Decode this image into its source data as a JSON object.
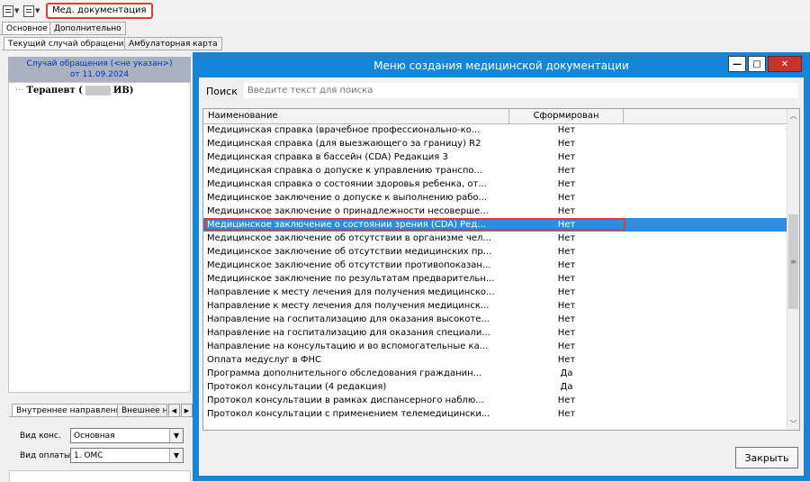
{
  "toolbar": {
    "menu_label": "Мед. документация",
    "icons": [
      "document-icon",
      "list-icon"
    ]
  },
  "top_tabs": [
    "Основное",
    "Дополнительно"
  ],
  "case_tabs": [
    "Текущий случай обращения",
    "Амбулаторная карта"
  ],
  "left_panel": {
    "case_title": "Случай обращения (<не указан>)",
    "case_date": "от 11.09.2024",
    "tree_item_prefix": "Терапевт (",
    "tree_item_suffix": " ИВ)",
    "bottom_tabs": [
      "Внутреннее направление",
      "Внешнее на"
    ],
    "fields": [
      {
        "label": "Вид конс.",
        "value": "Основная"
      },
      {
        "label": "Вид оплаты",
        "value": "1. ОМС"
      }
    ]
  },
  "dialog": {
    "title": "Меню создания медицинской документации",
    "search_label": "Поиск",
    "search_placeholder": "Введите текст для поиска",
    "columns": [
      "Наименование",
      "Сформирован"
    ],
    "selected_index": 7,
    "rows": [
      {
        "name": "Медицинская справка (врачебное профессионально-ко...",
        "status": "Нет"
      },
      {
        "name": "Медицинская справка (для выезжающего за границу) R2",
        "status": "Нет"
      },
      {
        "name": "Медицинская справка в бассейн (CDA) Редакция 3",
        "status": "Нет"
      },
      {
        "name": "Медицинская справка о допуске к управлению транспо...",
        "status": "Нет"
      },
      {
        "name": "Медицинская справка о состоянии здоровья ребенка, от...",
        "status": "Нет"
      },
      {
        "name": "Медицинское заключение о допуске к выполнению рабо...",
        "status": "Нет"
      },
      {
        "name": "Медицинское заключение о принадлежности несоверше...",
        "status": "Нет"
      },
      {
        "name": "Медицинское заключение о состоянии зрения (CDA) Ред...",
        "status": "Нет"
      },
      {
        "name": "Медицинское заключение об отсутствии в организме чел...",
        "status": "Нет"
      },
      {
        "name": "Медицинское заключение об отсутствии медицинских пр...",
        "status": "Нет"
      },
      {
        "name": "Медицинское заключение об отсутствии противопоказан...",
        "status": "Нет"
      },
      {
        "name": "Медицинское заключение по результатам предварительн...",
        "status": "Нет"
      },
      {
        "name": "Направление к месту лечения для получения медицинско...",
        "status": "Нет"
      },
      {
        "name": "Направление к месту лечения для получения медицинск...",
        "status": "Нет"
      },
      {
        "name": "Направление на госпитализацию для оказания высокоте...",
        "status": "Нет"
      },
      {
        "name": "Направление на госпитализацию для оказания специали...",
        "status": "Нет"
      },
      {
        "name": "Направление на консультацию и во вспомогательные ка...",
        "status": "Нет"
      },
      {
        "name": "Оплата медуслуг в ФНС",
        "status": "Нет"
      },
      {
        "name": "Программа дополнительного обследования гражданин...",
        "status": "Да"
      },
      {
        "name": "Протокол консультации (4 редакция)",
        "status": "Да"
      },
      {
        "name": "Протокол консультации в рамках диспансерного наблю...",
        "status": "Нет"
      },
      {
        "name": "Протокол консультации с применением телемедицински...",
        "status": "Нет"
      }
    ],
    "close_label": "Закрыть"
  }
}
